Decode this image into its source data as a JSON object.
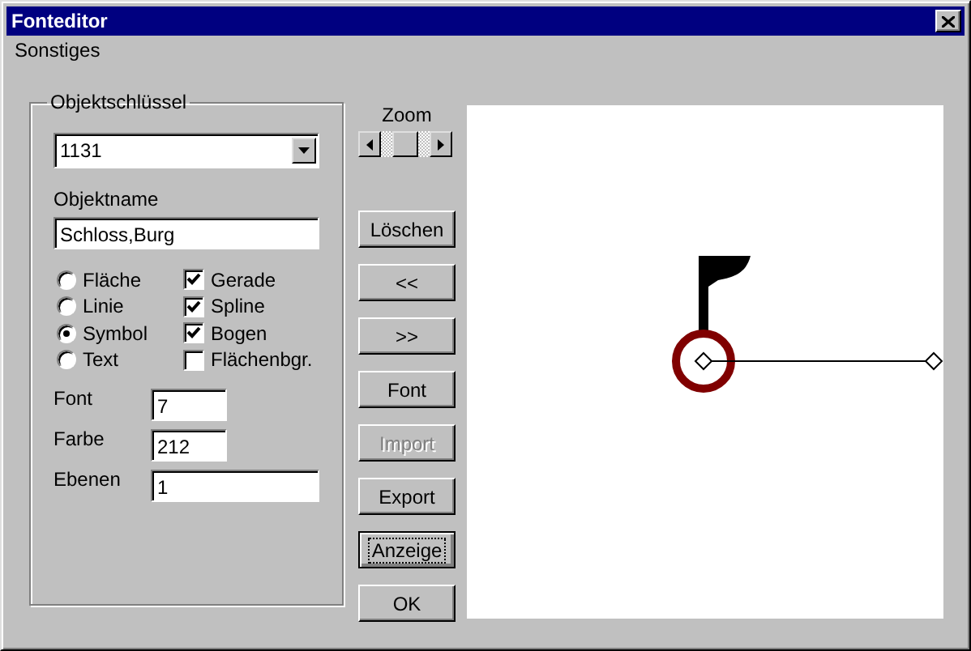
{
  "window": {
    "title": "Fonteditor"
  },
  "menu": [
    "Sonstiges"
  ],
  "group": {
    "legend": "Objektschlüssel",
    "key": "1131",
    "name_label": "Objektname",
    "name_value": "Schloss,Burg",
    "radios": [
      {
        "label": "Fläche",
        "selected": false
      },
      {
        "label": "Linie",
        "selected": false
      },
      {
        "label": "Symbol",
        "selected": true
      },
      {
        "label": "Text",
        "selected": false
      }
    ],
    "checkboxes": [
      {
        "label": "Gerade",
        "checked": true
      },
      {
        "label": "Spline",
        "checked": true
      },
      {
        "label": "Bogen",
        "checked": true
      },
      {
        "label": "Flächenbgr.",
        "checked": false
      }
    ],
    "fields": [
      {
        "label": "Font",
        "value": "7",
        "kind": "short"
      },
      {
        "label": "Farbe",
        "value": "212",
        "kind": "short"
      },
      {
        "label": "Ebenen",
        "value": "1",
        "kind": "long"
      }
    ]
  },
  "zoom": {
    "label": "Zoom"
  },
  "buttons": [
    {
      "label": "Löschen",
      "disabled": false,
      "focused": false
    },
    {
      "label": "<<",
      "disabled": false,
      "focused": false
    },
    {
      "label": ">>",
      "disabled": false,
      "focused": false
    },
    {
      "label": "Font",
      "disabled": false,
      "focused": false
    },
    {
      "label": "Import",
      "disabled": true,
      "focused": false
    },
    {
      "label": "Export",
      "disabled": false,
      "focused": false
    },
    {
      "label": "Anzeige",
      "disabled": false,
      "focused": true
    },
    {
      "label": "OK",
      "disabled": false,
      "focused": false
    }
  ]
}
